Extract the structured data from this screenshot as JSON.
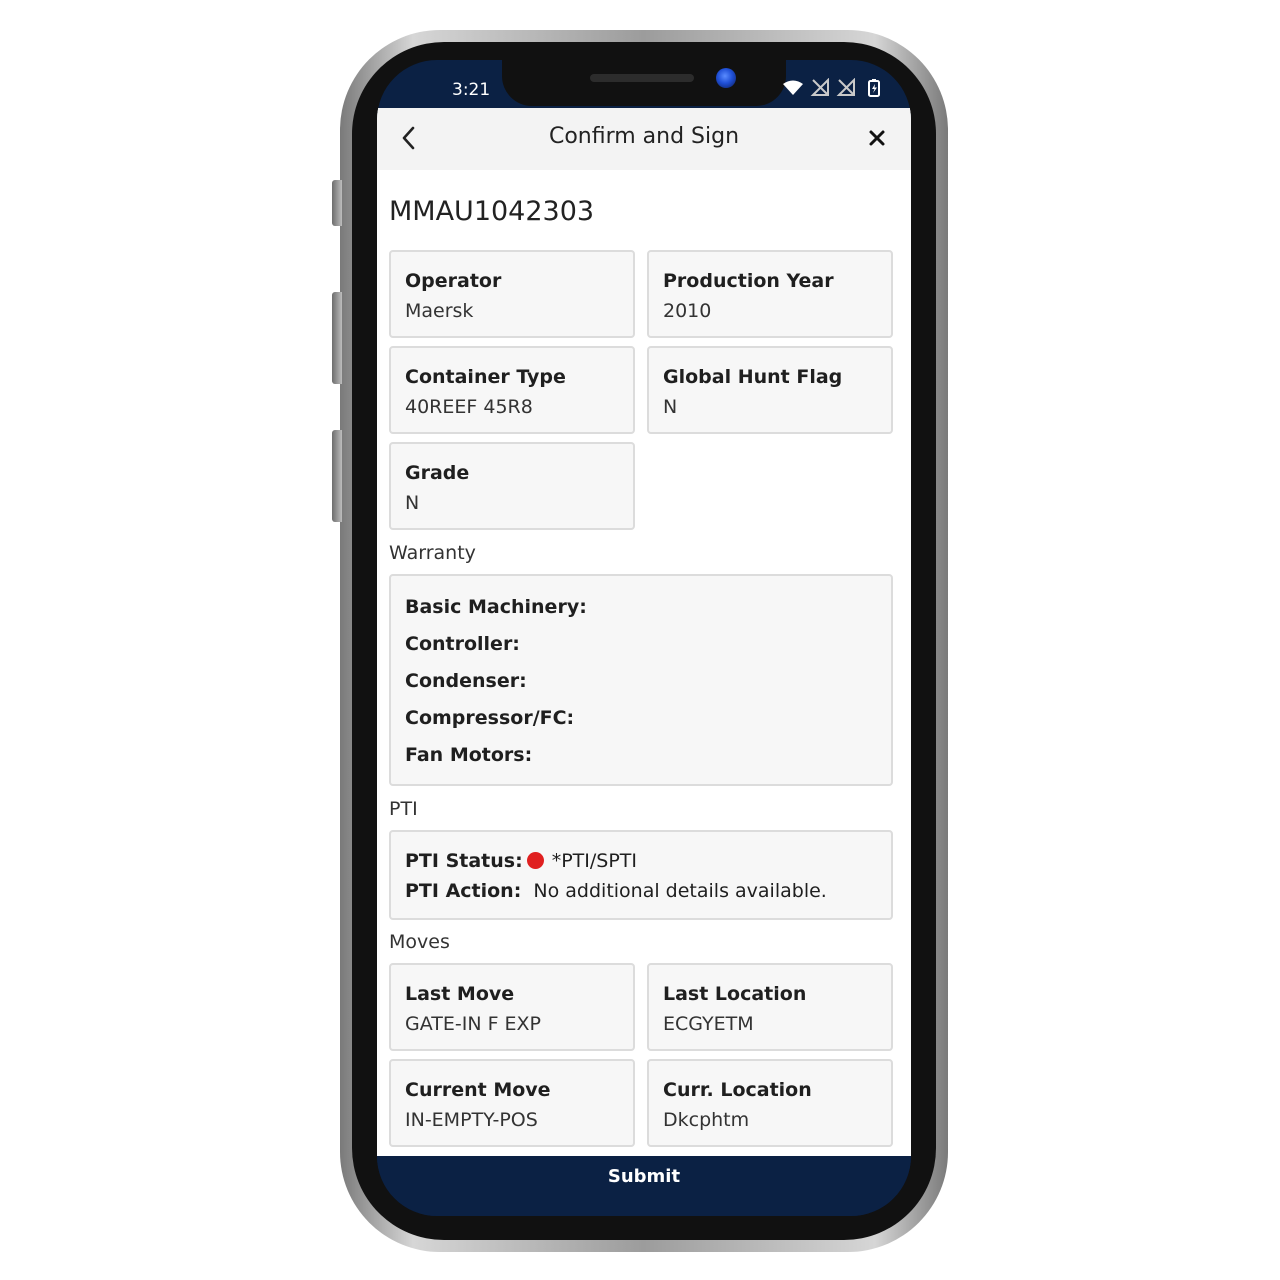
{
  "status_bar": {
    "time": "3:21",
    "icons": [
      "wifi-icon",
      "no-signal-icon",
      "no-signal-icon",
      "battery-icon"
    ]
  },
  "nav": {
    "title": "Confirm and Sign",
    "back_icon": "chevron-left-icon",
    "close_icon": "close-icon"
  },
  "container_id": "MMAU1042303",
  "details": {
    "operator": {
      "label": "Operator",
      "value": "Maersk"
    },
    "production_year": {
      "label": "Production Year",
      "value": "2010"
    },
    "container_type": {
      "label": "Container Type",
      "value": "40REEF 45R8"
    },
    "global_hunt_flag": {
      "label": "Global Hunt Flag",
      "value": "N"
    },
    "grade": {
      "label": "Grade",
      "value": "N"
    }
  },
  "warranty": {
    "section_label": "Warranty",
    "rows": [
      "Basic Machinery:",
      "Controller:",
      "Condenser:",
      "Compressor/FC:",
      "Fan Motors:"
    ]
  },
  "pti": {
    "section_label": "PTI",
    "status_label": "PTI Status:",
    "status_value": "*PTI/SPTI",
    "status_color": "#e02020",
    "action_label": "PTI Action:",
    "action_value": "No additional details available."
  },
  "moves": {
    "section_label": "Moves",
    "last_move": {
      "label": "Last Move",
      "value": "GATE-IN F EXP"
    },
    "last_location": {
      "label": "Last Location",
      "value": "ECGYETM"
    },
    "current_move": {
      "label": "Current Move",
      "value": "IN-EMPTY-POS"
    },
    "curr_location": {
      "label": "Curr. Location",
      "value": "Dkcphtm"
    }
  },
  "footer": {
    "submit_label": "Submit"
  },
  "colors": {
    "brand_navy": "#0b2144",
    "card_bg": "#f7f7f7",
    "card_border": "#dcdcdc"
  }
}
